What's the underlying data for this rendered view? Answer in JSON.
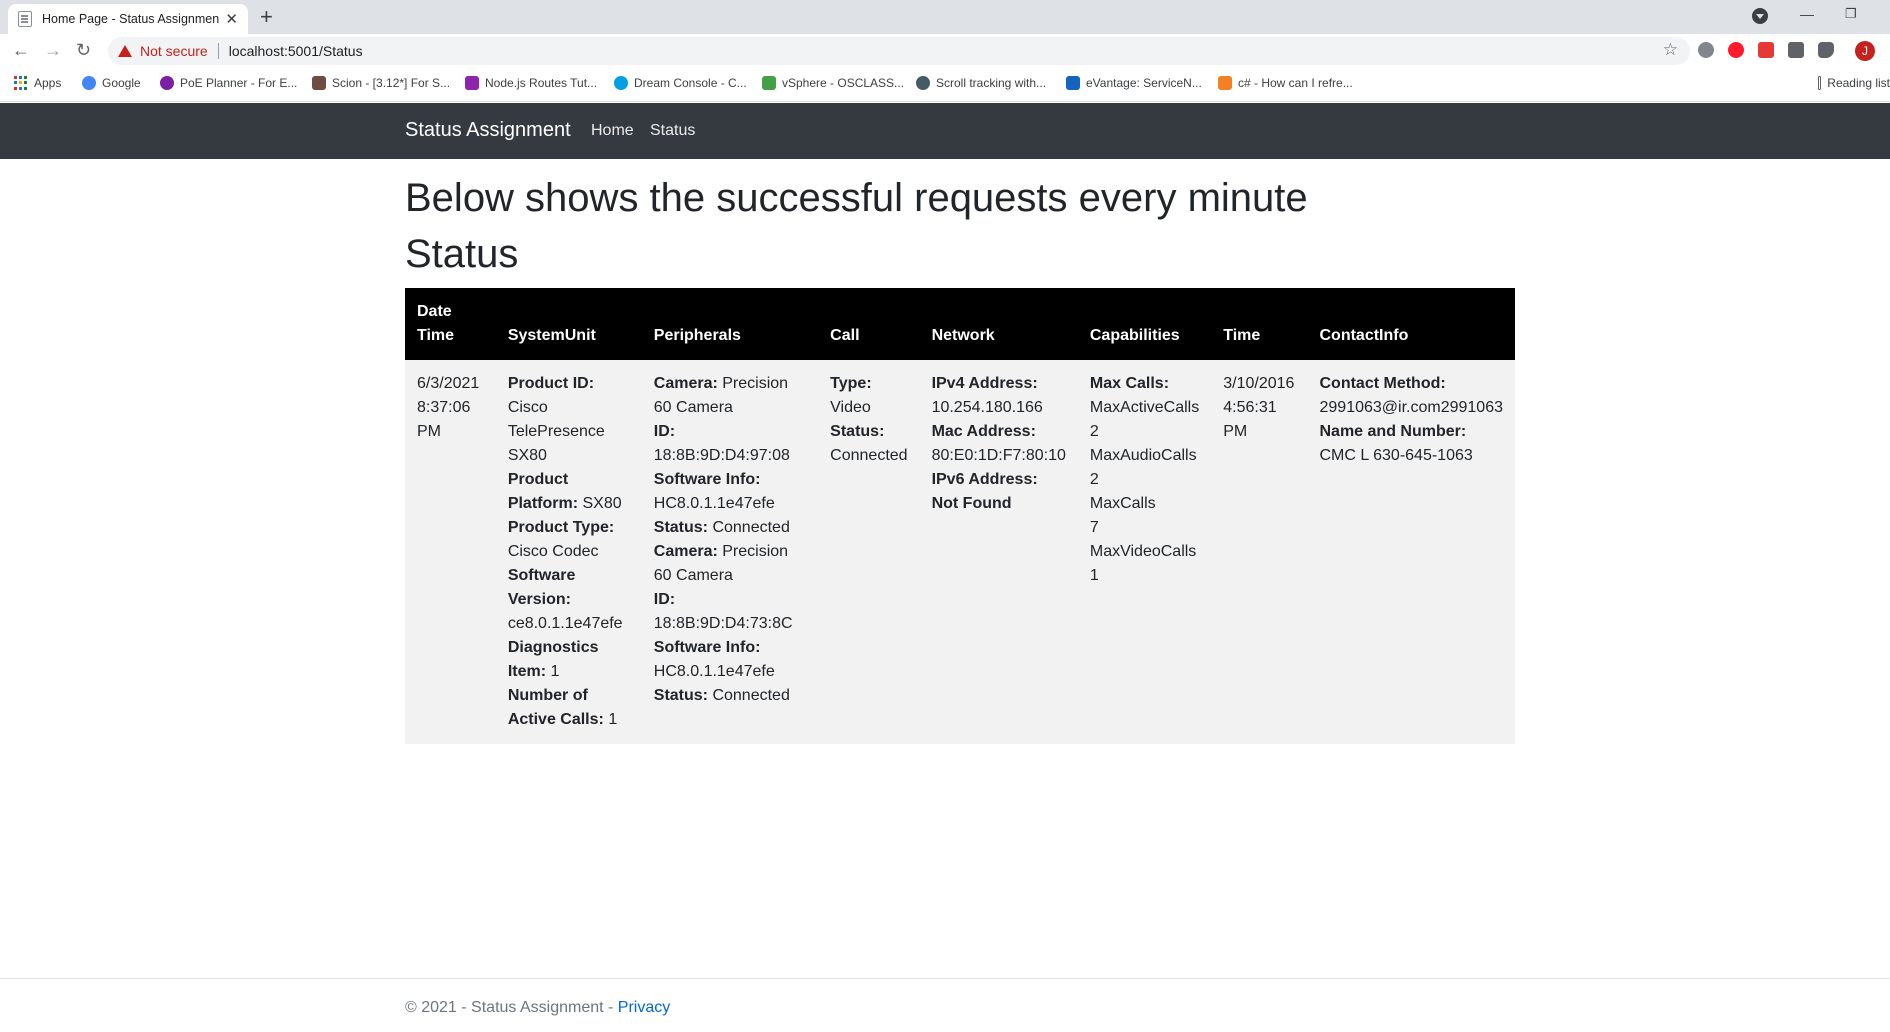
{
  "browser": {
    "tab_title": "Home Page - Status Assignment",
    "tab_close": "✕",
    "new_tab": "+",
    "not_secure": "Not secure",
    "url": "localhost:5001/Status",
    "profile_initial": "J",
    "reading_list": "Reading list"
  },
  "bookmarks": [
    {
      "label": "Apps",
      "icon": "apps-grid-icon"
    },
    {
      "label": "Google",
      "icon": "google-icon",
      "color": "#4285f4"
    },
    {
      "label": "PoE Planner - For E...",
      "icon": "poe-icon",
      "color": "#7b1fa2"
    },
    {
      "label": "Scion - [3.12*] For S...",
      "icon": "scion-icon",
      "color": "#6d4c41"
    },
    {
      "label": "Node.js Routes Tut...",
      "icon": "nodejs-icon",
      "color": "#8e24aa"
    },
    {
      "label": "Dream Console - C...",
      "icon": "salesforce-cloud-icon",
      "color": "#00a1e0"
    },
    {
      "label": "vSphere - OSCLASS...",
      "icon": "vsphere-icon",
      "color": "#43a047"
    },
    {
      "label": "Scroll tracking with...",
      "icon": "scroll-icon",
      "color": "#455a64"
    },
    {
      "label": "eVantage: ServiceN...",
      "icon": "evantage-icon",
      "color": "#1565c0"
    },
    {
      "label": "c# - How can I refre...",
      "icon": "stackoverflow-icon",
      "color": "#f48024"
    }
  ],
  "site": {
    "brand": "Status Assignment",
    "nav": [
      "Home",
      "Status"
    ]
  },
  "main": {
    "heading1": "Below shows the successful requests every minute",
    "heading2": "Status"
  },
  "table": {
    "headers": [
      "Date Time",
      "SystemUnit",
      "Peripherals",
      "Call",
      "Network",
      "Capabilities",
      "Time",
      "ContactInfo"
    ],
    "row": {
      "datetime": "6/3/2021 8:37:06 PM",
      "system_unit": [
        {
          "label": "Product ID:",
          "value": "Cisco TelePresence SX80"
        },
        {
          "label": "Product Platform:",
          "value": "SX80"
        },
        {
          "label": "Product Type:",
          "value": "Cisco Codec"
        },
        {
          "label": "Software Version:",
          "value": "ce8.0.1.1e47efe"
        },
        {
          "label": "Diagnostics Item:",
          "value": "1"
        },
        {
          "label": "Number of Active Calls:",
          "value": "1"
        }
      ],
      "peripherals": [
        {
          "label": "Camera:",
          "value": "Precision 60 Camera"
        },
        {
          "label": "ID:",
          "value": "18:8B:9D:D4:97:08"
        },
        {
          "label": "Software Info:",
          "value": "HC8.0.1.1e47efe"
        },
        {
          "label": "Status:",
          "value": "Connected"
        },
        {
          "label": "Camera:",
          "value": "Precision 60 Camera"
        },
        {
          "label": "ID:",
          "value": "18:8B:9D:D4:73:8C"
        },
        {
          "label": "Software Info:",
          "value": "HC8.0.1.1e47efe"
        },
        {
          "label": "Status:",
          "value": "Connected"
        }
      ],
      "call": [
        {
          "label": "Type:",
          "value": "Video"
        },
        {
          "label": "Status:",
          "value": "Connected"
        }
      ],
      "network": [
        {
          "label": "IPv4 Address:",
          "value": "10.254.180.166"
        },
        {
          "label": "Mac Address:",
          "value": "80:E0:1D:F7:80:10"
        },
        {
          "label": "IPv6 Address:",
          "value": "Not Found"
        }
      ],
      "capabilities": {
        "label": "Max Calls:",
        "items": [
          {
            "name": "MaxActiveCalls",
            "value": "2"
          },
          {
            "name": "MaxAudioCalls",
            "value": "2"
          },
          {
            "name": "MaxCalls",
            "value": "7"
          },
          {
            "name": "MaxVideoCalls",
            "value": "1"
          }
        ]
      },
      "time": "3/10/2016 4:56:31 PM",
      "contact": [
        {
          "label": "Contact Method:",
          "value": "2991063@ir.com2991063"
        },
        {
          "label": "Name and Number:",
          "value": "CMC L 630-645-1063"
        }
      ]
    }
  },
  "footer": {
    "copyright": "© 2021 - Status Assignment -",
    "privacy": "Privacy"
  }
}
